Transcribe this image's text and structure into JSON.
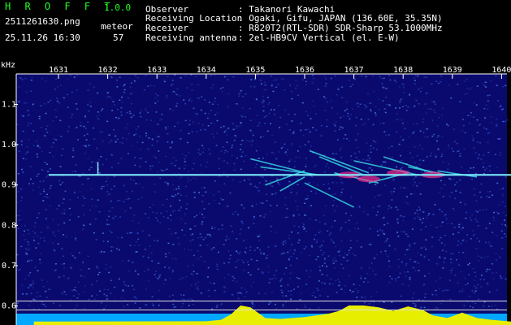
{
  "app": {
    "name": "H R O F F T",
    "version": "1.0.0"
  },
  "file": {
    "filename": "2511261630.png",
    "datetime": "25.11.26 16:30"
  },
  "meteor": {
    "label": "meteor",
    "count": "57"
  },
  "info": {
    "observer_label": "Observer",
    "observer_value": ": Takanori Kawachi",
    "location_label": "Receiving Location",
    "location_value": ": Ogaki, Gifu, JAPAN (136.60E, 35.35N)",
    "receiver_label": "Receiver",
    "receiver_value": ": R820T2(RTL-SDR) SDR-Sharp 53.1000MHz",
    "antenna_label": "Receiving antenna",
    "antenna_value": ": 2el-HB9CV Vertical (el. E-W)"
  },
  "chart_data": {
    "type": "heatmap",
    "ylabel": "kHz",
    "x_ticks": [
      "1631",
      "1632",
      "1633",
      "1634",
      "1635",
      "1636",
      "1637",
      "1638",
      "1639",
      "1640"
    ],
    "y_ticks": [
      "1.1",
      "1.0",
      "0.9",
      "0.8",
      "0.7",
      "0.6"
    ],
    "ylim": [
      0.58,
      1.17
    ],
    "xlim": [
      1630.5,
      1640.2
    ],
    "carrier": {
      "freq_khz": 0.925,
      "x_start": 1630.8,
      "x_end": 1640.2
    },
    "echoes": [
      {
        "x0": 1634.9,
        "y0": 0.965,
        "x1": 1636.2,
        "y1": 0.925
      },
      {
        "x0": 1635.1,
        "y0": 0.945,
        "x1": 1636.3,
        "y1": 0.925
      },
      {
        "x0": 1635.2,
        "y0": 0.9,
        "x1": 1636.0,
        "y1": 0.935
      },
      {
        "x0": 1635.5,
        "y0": 0.885,
        "x1": 1636.0,
        "y1": 0.92
      },
      {
        "x0": 1636.0,
        "y0": 0.905,
        "x1": 1637.0,
        "y1": 0.845
      },
      {
        "x0": 1636.1,
        "y0": 0.985,
        "x1": 1637.3,
        "y1": 0.93
      },
      {
        "x0": 1636.3,
        "y0": 0.97,
        "x1": 1637.2,
        "y1": 0.925
      },
      {
        "x0": 1636.6,
        "y0": 0.93,
        "x1": 1637.5,
        "y1": 0.905
      },
      {
        "x0": 1637.0,
        "y0": 0.96,
        "x1": 1638.3,
        "y1": 0.925
      },
      {
        "x0": 1637.3,
        "y0": 0.905,
        "x1": 1638.1,
        "y1": 0.93
      },
      {
        "x0": 1637.6,
        "y0": 0.97,
        "x1": 1638.6,
        "y1": 0.93
      },
      {
        "x0": 1638.1,
        "y0": 0.945,
        "x1": 1638.9,
        "y1": 0.925
      },
      {
        "x0": 1638.7,
        "y0": 0.935,
        "x1": 1639.5,
        "y1": 0.92
      }
    ],
    "strong_blobs": [
      {
        "x": 1636.9,
        "y": 0.925
      },
      {
        "x": 1637.9,
        "y": 0.93
      },
      {
        "x": 1638.6,
        "y": 0.925
      },
      {
        "x": 1637.3,
        "y": 0.915
      }
    ],
    "activity_profile": [
      {
        "x": 1630.5,
        "v": 0.1
      },
      {
        "x": 1634.0,
        "v": 0.12
      },
      {
        "x": 1634.3,
        "v": 0.2
      },
      {
        "x": 1634.5,
        "v": 0.5
      },
      {
        "x": 1634.7,
        "v": 1.0
      },
      {
        "x": 1634.9,
        "v": 0.9
      },
      {
        "x": 1635.1,
        "v": 0.5
      },
      {
        "x": 1635.2,
        "v": 0.3
      },
      {
        "x": 1635.5,
        "v": 0.25
      },
      {
        "x": 1636.0,
        "v": 0.35
      },
      {
        "x": 1636.5,
        "v": 0.55
      },
      {
        "x": 1636.7,
        "v": 0.7
      },
      {
        "x": 1636.9,
        "v": 1.0
      },
      {
        "x": 1637.2,
        "v": 1.0
      },
      {
        "x": 1637.5,
        "v": 0.9
      },
      {
        "x": 1637.8,
        "v": 0.7
      },
      {
        "x": 1638.1,
        "v": 0.95
      },
      {
        "x": 1638.4,
        "v": 0.75
      },
      {
        "x": 1638.6,
        "v": 0.45
      },
      {
        "x": 1638.9,
        "v": 0.3
      },
      {
        "x": 1639.2,
        "v": 0.6
      },
      {
        "x": 1639.5,
        "v": 0.3
      },
      {
        "x": 1639.8,
        "v": 0.2
      },
      {
        "x": 1640.2,
        "v": 0.1
      }
    ]
  }
}
